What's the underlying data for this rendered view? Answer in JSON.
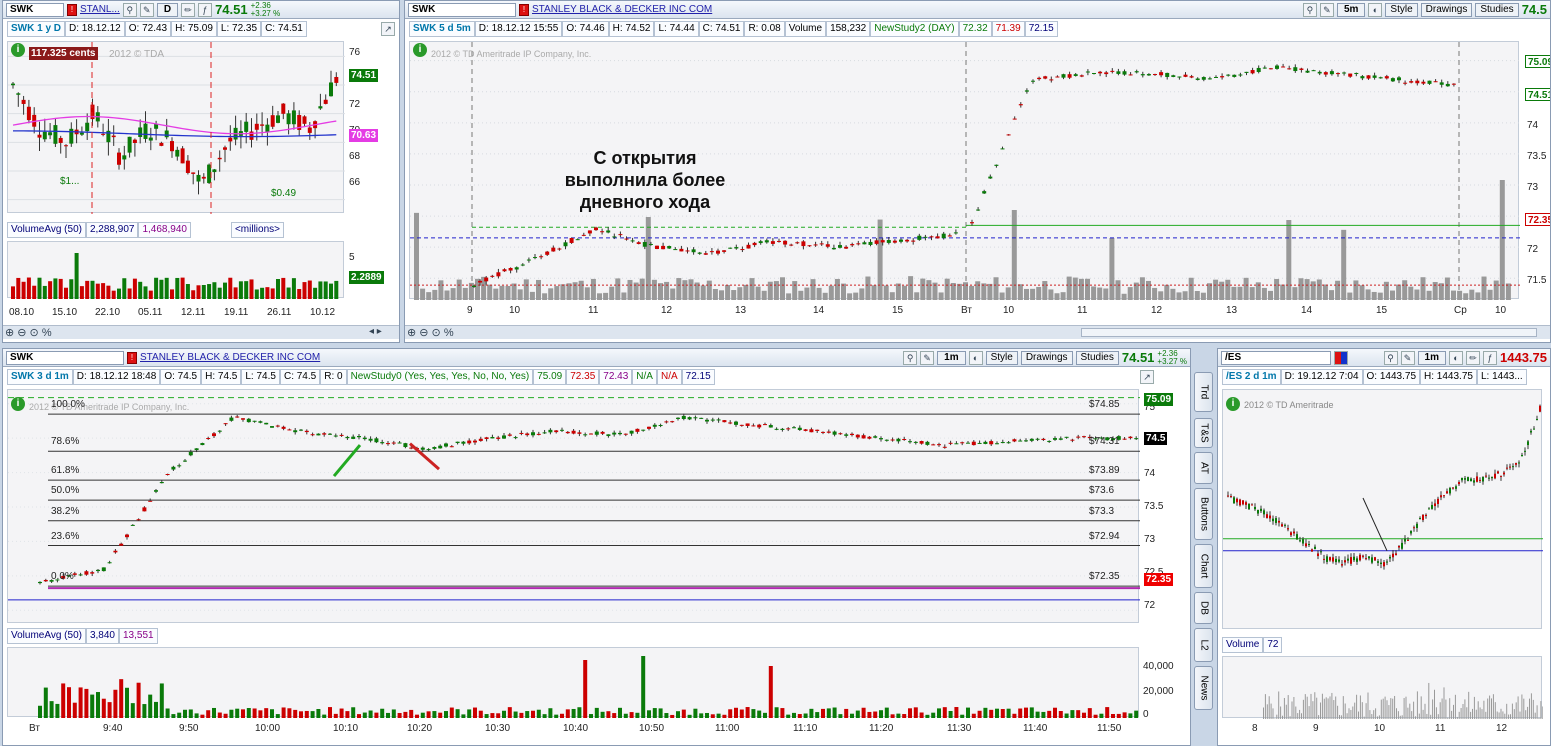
{
  "colors": {
    "up": "#0a7a0a",
    "down": "#cc0000",
    "accent": "#1f7ad1",
    "volume": "#888888"
  },
  "pane1": {
    "symbol": "SWK",
    "company_short": "STANL...",
    "period_btn": "D",
    "last": "74.51",
    "change_abs": "+2.36",
    "change_pct": "+3.27 %",
    "info": {
      "title": "SWK 1 y D",
      "date": "D: 18.12.12",
      "open": "O: 72.43",
      "high": "H: 75.09",
      "low": "L: 72.35",
      "close": "C: 74.51"
    },
    "watermark": "2012 © TDA",
    "cents_tag": "117.325 cents",
    "dividend_1": "$1...",
    "dividend_2": "$0.49",
    "y_ticks": [
      "76",
      "74",
      "72",
      "70",
      "68",
      "66"
    ],
    "price_tag": "74.51",
    "ma_tag": "70.63",
    "vol": {
      "title": "VolumeAvg (50)",
      "v1": "2,288,907",
      "v2": "1,468,940",
      "units": "<millions>",
      "y_ticks": [
        "5",
        "2.5"
      ],
      "tag": "2.2889"
    },
    "x_labels": [
      "08.10",
      "15.10",
      "22.10",
      "05.11",
      "12.11",
      "19.11",
      "26.11",
      "10.12"
    ]
  },
  "pane2": {
    "symbol": "SWK",
    "company": "STANLEY BLACK & DECKER INC COM",
    "period_btn": "5m",
    "style": "Style",
    "drawings": "Drawings",
    "studies": "Studies",
    "last": "74.5",
    "info": {
      "title": "SWK 5 d 5m",
      "date": "D: 18.12.12 15:55",
      "open": "O: 74.46",
      "high": "H: 74.52",
      "low": "L: 74.44",
      "close": "C: 74.51",
      "range": "R: 0.08",
      "volume_label": "Volume",
      "volume": "158,232",
      "study": "NewStudy2 (DAY)",
      "s1": "72.32",
      "s2": "71.39",
      "s3": "72.15"
    },
    "watermark": "2012 © TD Ameritrade IP Company, Inc.",
    "annotation": "С открытия\nвыполнила более\nдневного хода",
    "y_ticks": [
      "75",
      "74.5",
      "74",
      "73.5",
      "73",
      "72.5",
      "72",
      "71.5"
    ],
    "tag_a": "75.09",
    "tag_b": "74.51",
    "tag_c": "72.35",
    "x_labels": [
      "9",
      "10",
      "11",
      "12",
      "13",
      "14",
      "15",
      "Вт",
      "10",
      "11",
      "12",
      "13",
      "14",
      "15",
      "Ср",
      "10"
    ]
  },
  "pane3": {
    "symbol": "SWK",
    "company": "STANLEY BLACK & DECKER INC COM",
    "period_btn": "1m",
    "style": "Style",
    "drawings": "Drawings",
    "studies": "Studies",
    "last": "74.51",
    "change_abs": "+2.36",
    "change_pct": "+3.27 %",
    "info": {
      "title": "SWK 3 d 1m",
      "date": "D: 18.12.12 18:48",
      "open": "O: 74.5",
      "high": "H: 74.5",
      "low": "L: 74.5",
      "close": "C: 74.5",
      "range": "R: 0",
      "study": "NewStudy0 (Yes, Yes, Yes, No, No, Yes)",
      "s1": "75.09",
      "s2": "72.35",
      "s3": "72.43",
      "na1": "N/A",
      "na2": "N/A",
      "s4": "72.15"
    },
    "watermark": "2012 © TD Ameritrade IP Company, Inc.",
    "fib": [
      {
        "pct": "100.0%",
        "price": "$74.85"
      },
      {
        "pct": "78.6%",
        "price": "$74.31"
      },
      {
        "pct": "61.8%",
        "price": "$73.89"
      },
      {
        "pct": "50.0%",
        "price": "$73.6"
      },
      {
        "pct": "38.2%",
        "price": "$73.3"
      },
      {
        "pct": "23.6%",
        "price": "$72.94"
      },
      {
        "pct": "0.0%",
        "price": "$72.35"
      }
    ],
    "y_ticks": [
      "75",
      "74.5",
      "74",
      "73.5",
      "73",
      "72.5",
      "72"
    ],
    "tag_top": "75.09",
    "tag_last": "74.5",
    "tag_low": "72.35",
    "vol": {
      "title": "VolumeAvg (50)",
      "v1": "3,840",
      "v2": "13,551",
      "y_ticks": [
        "40,000",
        "20,000",
        "0"
      ]
    },
    "x_labels": [
      "Вт",
      "9:40",
      "9:50",
      "10:00",
      "10:10",
      "10:20",
      "10:30",
      "10:40",
      "10:50",
      "11:00",
      "11:10",
      "11:20",
      "11:30",
      "11:40",
      "11:50"
    ]
  },
  "sidebar": {
    "tabs": [
      "Trd",
      "T&S",
      "AT",
      "Buttons",
      "Chart",
      "DB",
      "L2",
      "News"
    ]
  },
  "pane4": {
    "symbol": "/ES",
    "period_btn": "1m",
    "last": "1443.75",
    "info": {
      "title": "/ES 2 d 1m",
      "date": "D: 19.12.12 7:04",
      "open": "O: 1443.75",
      "high": "H: 1443.75",
      "low": "L: 1443..."
    },
    "watermark": "2012 © TD Ameritrade",
    "vol": {
      "title": "Volume",
      "value": "72"
    },
    "x_labels": [
      "8",
      "9",
      "10",
      "11",
      "12"
    ]
  }
}
